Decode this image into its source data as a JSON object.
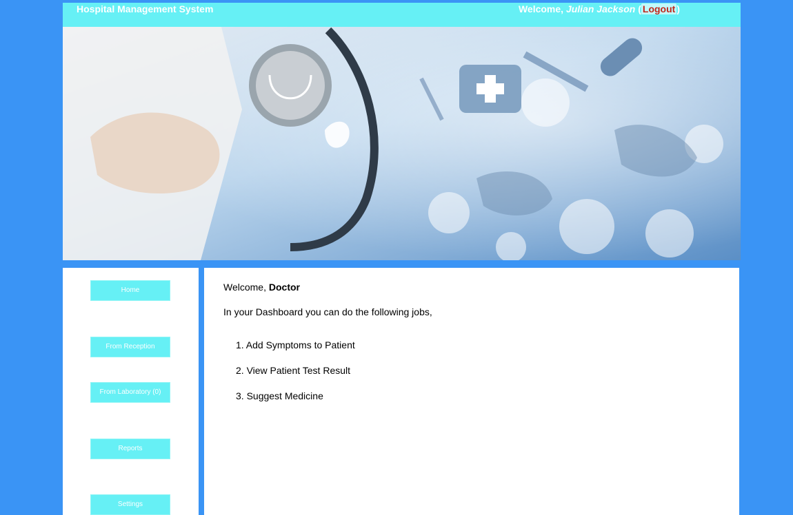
{
  "header": {
    "app_title": "Hospital Management System",
    "welcome_prefix": "Welcome, ",
    "user_name": "Julian Jackson",
    "logout_open": " (",
    "logout_label": "Logout",
    "logout_close": ")"
  },
  "sidebar": {
    "items": [
      {
        "label": "Home"
      },
      {
        "label": "From Reception"
      },
      {
        "label": "From Laboratory (0)"
      },
      {
        "label": "Reports"
      },
      {
        "label": "Settings"
      }
    ]
  },
  "main": {
    "greeting_prefix": "Welcome, ",
    "greeting_role": "Doctor",
    "intro": "In your Dashboard you can do the following jobs,",
    "jobs": [
      "1. Add Symptoms to Patient",
      "2. View Patient Test Result",
      "3. Suggest Medicine"
    ]
  },
  "colors": {
    "page_background": "#3a94f5",
    "accent": "#66f0f5",
    "logout": "#c0281c"
  }
}
